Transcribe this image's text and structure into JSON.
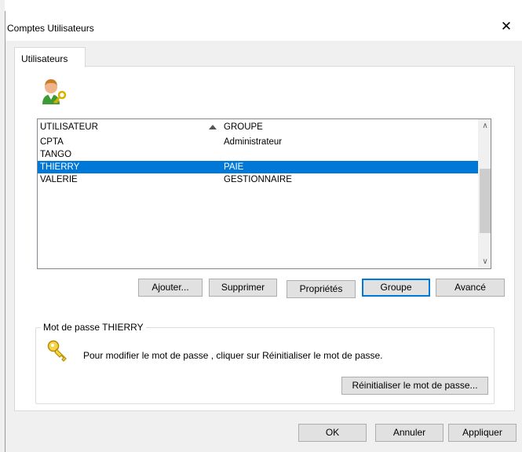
{
  "window": {
    "title": "Comptes Utilisateurs",
    "close_symbol": "✕"
  },
  "tabs": [
    {
      "label": "Utilisateurs"
    }
  ],
  "list": {
    "columns": [
      {
        "label": "UTILISATEUR"
      },
      {
        "label": "GROUPE"
      }
    ],
    "rows": [
      {
        "user": "CPTA",
        "group": "Administrateur"
      },
      {
        "user": "TANGO",
        "group": ""
      },
      {
        "user": "THIERRY",
        "group": "PAIE"
      },
      {
        "user": "VALERIE",
        "group": "GESTIONNAIRE"
      }
    ],
    "selected_user": "THIERRY"
  },
  "actions": {
    "add": "Ajouter...",
    "delete": "Supprimer",
    "properties": "Propriétés",
    "group": "Groupe",
    "advanced": "Avancé"
  },
  "password_group": {
    "title": "Mot de passe THIERRY",
    "instruction": "Pour modifier le mot de passe , cliquer sur  Réinitialiser le mot de passe.",
    "reset_button": "Réinitialiser le mot de passe..."
  },
  "footer": {
    "ok": "OK",
    "cancel": "Annuler",
    "apply": "Appliquer"
  },
  "colors": {
    "selection": "#0078d7",
    "dialog_bg": "#f0f0f0"
  }
}
